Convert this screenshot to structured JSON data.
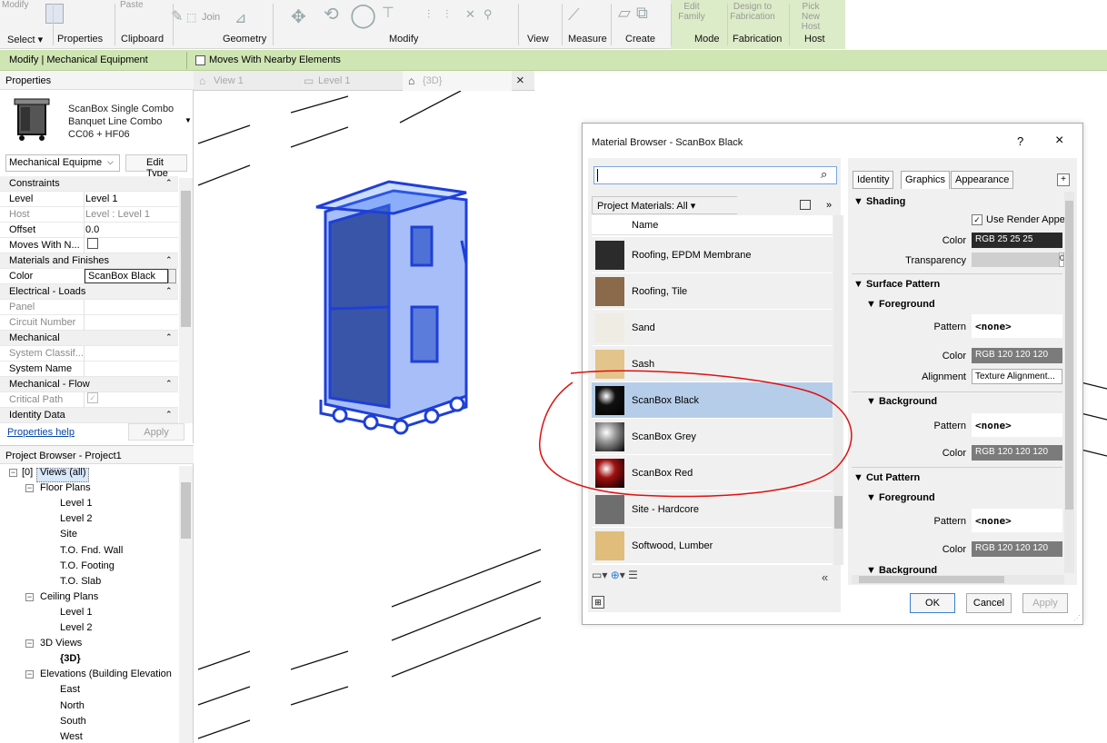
{
  "ribbon": {
    "faded_labels": [
      "Modify",
      "Paste",
      "Join",
      "Edit Family",
      "Design to Fabrication",
      "Pick New Host"
    ],
    "panels": [
      "Select",
      "Properties",
      "Clipboard",
      "Geometry",
      "Modify",
      "View",
      "Measure",
      "Create",
      "Mode",
      "Fabrication",
      "Host"
    ],
    "select_arrow": "▾"
  },
  "context_bar": {
    "title": "Modify | Mechanical Equipment",
    "option_label": "Moves With Nearby Elements"
  },
  "properties": {
    "title": "Properties",
    "type_lines": [
      "ScanBox Single Combo",
      "Banquet Line Combo",
      "CC06 + HF06"
    ],
    "category_select": "Mechanical Equipme",
    "edit_type": "Edit Type",
    "rows": [
      {
        "group": true,
        "k": "Constraints",
        "chev": "⌃"
      },
      {
        "k": "Level",
        "v": "Level 1"
      },
      {
        "k": "Host",
        "v": "Level : Level 1",
        "dim": true
      },
      {
        "k": "Offset",
        "v": "0.0"
      },
      {
        "k": "Moves With N...",
        "v": ""
      },
      {
        "group": true,
        "k": "Materials and Finishes",
        "chev": "⌃"
      },
      {
        "k": "Color",
        "v": ""
      },
      {
        "group": true,
        "k": "Electrical - Loads",
        "chev": "⌃"
      },
      {
        "k": "Panel",
        "v": "",
        "dim": true
      },
      {
        "k": "Circuit Number",
        "v": "",
        "dim": true
      },
      {
        "group": true,
        "k": "Mechanical",
        "chev": "⌃"
      },
      {
        "k": "System Classif...",
        "v": "",
        "dim": true
      },
      {
        "k": "System Name",
        "v": ""
      },
      {
        "group": true,
        "k": "Mechanical - Flow",
        "chev": "⌃"
      },
      {
        "k": "Critical Path",
        "v": "",
        "dim": true
      },
      {
        "group": true,
        "k": "Identity Data",
        "chev": "⌃"
      }
    ],
    "color_value": "ScanBox Black",
    "help_link": "Properties help",
    "apply": "Apply"
  },
  "project_browser": {
    "title": "Project Browser - Project1",
    "tree": [
      {
        "label": "Views (all)",
        "indent": 0,
        "node": true,
        "icon": "[0]"
      },
      {
        "label": "Floor Plans",
        "indent": 1,
        "node": true
      },
      {
        "label": "Level 1",
        "indent": 2
      },
      {
        "label": "Level 2",
        "indent": 2
      },
      {
        "label": "Site",
        "indent": 2
      },
      {
        "label": "T.O. Fnd. Wall",
        "indent": 2
      },
      {
        "label": "T.O. Footing",
        "indent": 2
      },
      {
        "label": "T.O. Slab",
        "indent": 2
      },
      {
        "label": "Ceiling Plans",
        "indent": 1,
        "node": true
      },
      {
        "label": "Level 1",
        "indent": 2
      },
      {
        "label": "Level 2",
        "indent": 2
      },
      {
        "label": "3D Views",
        "indent": 1,
        "node": true
      },
      {
        "label": "{3D}",
        "indent": 2,
        "bold": true
      },
      {
        "label": "Elevations (Building Elevation",
        "indent": 1,
        "node": true
      },
      {
        "label": "East",
        "indent": 2
      },
      {
        "label": "North",
        "indent": 2
      },
      {
        "label": "South",
        "indent": 2
      },
      {
        "label": "West",
        "indent": 2
      }
    ]
  },
  "view_tabs": [
    {
      "label": "View 1",
      "icon": "⌂"
    },
    {
      "label": "Level 1",
      "icon": "▭"
    },
    {
      "label": "{3D}",
      "icon": "⌂",
      "active": true
    }
  ],
  "tab_close": "×",
  "material_browser": {
    "title": "Material Browser - ScanBox Black",
    "help": "?",
    "close": "×",
    "filter": "Project Materials: All  ▾",
    "more": "»",
    "list_header": "Name",
    "materials": [
      {
        "name": "Roofing, EPDM Membrane",
        "swatch": "#2b2b2b"
      },
      {
        "name": "Roofing, Tile",
        "swatch": "#8a6a4a"
      },
      {
        "name": "Sand",
        "swatch": "#efece3"
      },
      {
        "name": "Sash",
        "swatch": "#e3c48b"
      },
      {
        "name": "ScanBox Black",
        "swatch": "#111111",
        "selected": true
      },
      {
        "name": "ScanBox Grey",
        "swatch": "#9a9a9a"
      },
      {
        "name": "ScanBox Red",
        "swatch": "#a01010"
      },
      {
        "name": "Site - Hardcore",
        "swatch": "#6e6e6e"
      },
      {
        "name": "Softwood, Lumber",
        "swatch": "#e0bd7a"
      }
    ],
    "collapse": "«",
    "tabs": [
      "Identity",
      "Graphics",
      "Appearance"
    ],
    "tab_plus": "+",
    "shading": {
      "title": "▼ Shading",
      "use_render": "Use Render Appe",
      "color_label": "Color",
      "color_value": "RGB 25 25 25",
      "transparency_label": "Transparency",
      "transparency_value": "0"
    },
    "surface_pattern": {
      "title": "▼ Surface Pattern",
      "foreground": "▼ Foreground",
      "pattern_label": "Pattern",
      "pattern_value": "<none>",
      "color_label": "Color",
      "color_value": "RGB 120 120 120",
      "alignment_label": "Alignment",
      "alignment_value": "Texture Alignment...",
      "background": "▼ Background",
      "bg_pattern_label": "Pattern",
      "bg_pattern_value": "<none>",
      "bg_color_label": "Color",
      "bg_color_value": "RGB 120 120 120"
    },
    "cut_pattern": {
      "title": "▼ Cut Pattern",
      "foreground": "▼ Foreground",
      "pattern_label": "Pattern",
      "pattern_value": "<none>",
      "color_label": "Color",
      "color_value": "RGB 120 120 120",
      "background": "▼ Background"
    },
    "buttons": {
      "ok": "OK",
      "cancel": "Cancel",
      "apply": "Apply"
    }
  },
  "colors": {
    "context_green": "#cfe6b4",
    "selection_blue": "#b6cde9",
    "model_blue": "#1f3fd6",
    "annotation_red": "#e01010"
  }
}
